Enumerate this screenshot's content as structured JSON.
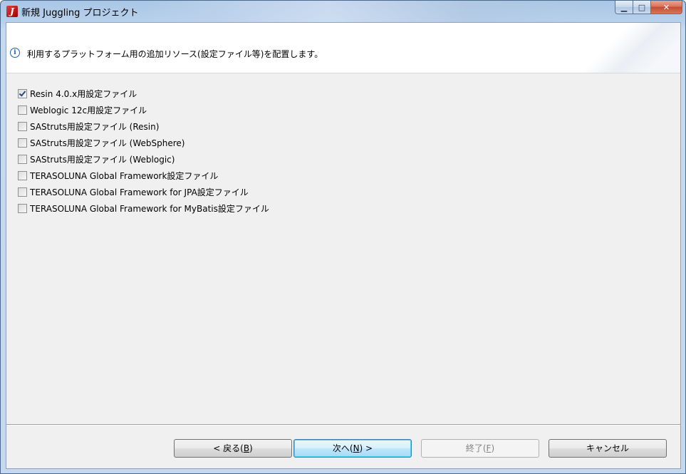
{
  "window": {
    "title": "新規 Juggling プロジェクト",
    "controls": {
      "minimize": "▁",
      "maximize": "□",
      "close": "✕"
    }
  },
  "banner": {
    "message": "利用するプラットフォーム用の追加リソース(設定ファイル等)を配置します。"
  },
  "options": [
    {
      "label": "Resin 4.0.x用設定ファイル",
      "checked": true
    },
    {
      "label": "Weblogic 12c用設定ファイル",
      "checked": false
    },
    {
      "label": "SAStruts用設定ファイル (Resin)",
      "checked": false
    },
    {
      "label": "SAStruts用設定ファイル (WebSphere)",
      "checked": false
    },
    {
      "label": "SAStruts用設定ファイル (Weblogic)",
      "checked": false
    },
    {
      "label": "TERASOLUNA Global Framework設定ファイル",
      "checked": false
    },
    {
      "label": "TERASOLUNA Global Framework for JPA設定ファイル",
      "checked": false
    },
    {
      "label": "TERASOLUNA Global Framework for MyBatis設定ファイル",
      "checked": false
    }
  ],
  "buttons": {
    "back": {
      "pre": "< 戻る(",
      "mn": "B",
      "post": ")"
    },
    "next": {
      "pre": "次へ(",
      "mn": "N",
      "post": ") >"
    },
    "finish": {
      "pre": "終了(",
      "mn": "F",
      "post": ")"
    },
    "cancel": {
      "label": "キャンセル"
    }
  },
  "colors": {
    "accent": "#3c7fb1",
    "info": "#1b5fad"
  }
}
